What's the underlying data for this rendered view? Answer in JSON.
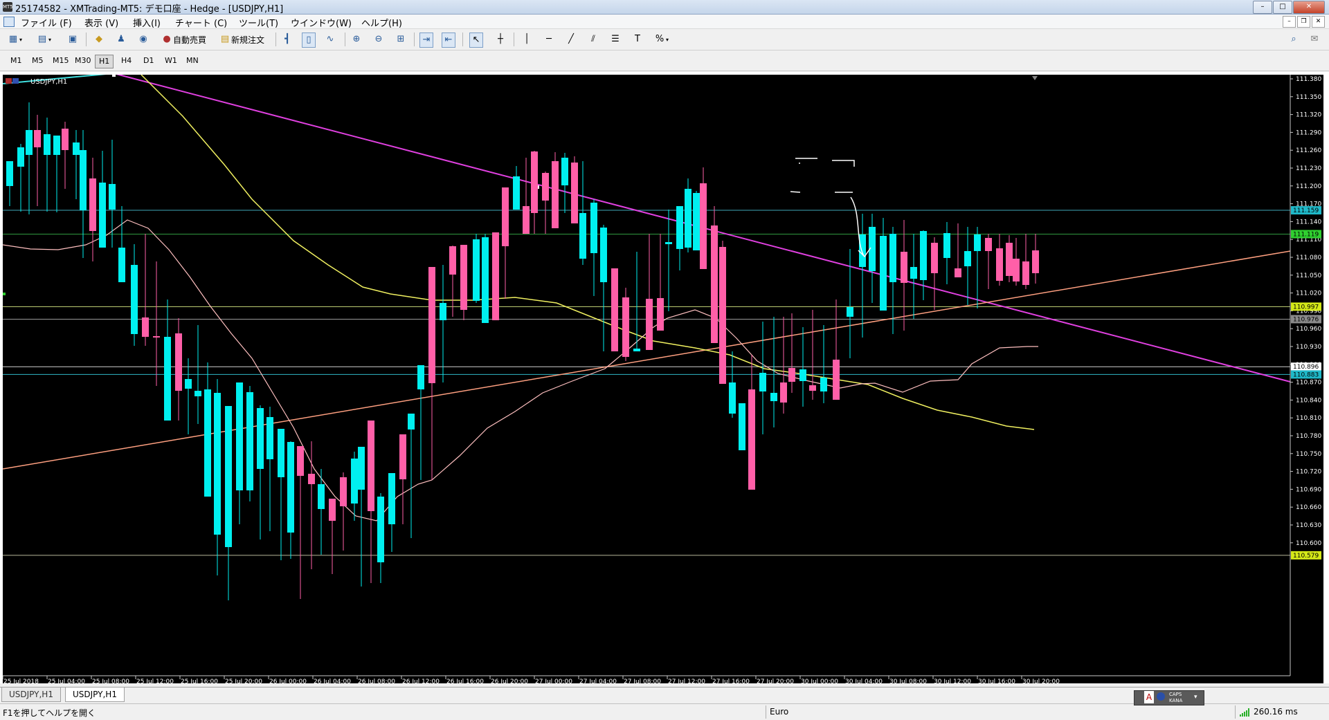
{
  "window": {
    "title": "25174582 - XMTrading-MT5: デモ口座 - Hedge - [USDJPY,H1]",
    "app_icon_text": "MT5",
    "min": "–",
    "max": "□",
    "close": "✕"
  },
  "mdi": {
    "min": "–",
    "restore": "❐",
    "close": "✕"
  },
  "menu": [
    "ファイル (F)",
    "表示 (V)",
    "挿入(I)",
    "チャート (C)",
    "ツール(T)",
    "ウインドウ(W)",
    "ヘルプ(H)"
  ],
  "toolbar": {
    "auto_trading": "自動売買",
    "new_order": "新規注文"
  },
  "timeframes": [
    "M1",
    "M5",
    "M15",
    "M30",
    "H1",
    "H4",
    "D1",
    "W1",
    "MN"
  ],
  "active_timeframe": "H1",
  "chart": {
    "symbol_label": "USDJPY,H1",
    "price_labels": [
      "111.380",
      "111.350",
      "111.320",
      "111.290",
      "111.260",
      "111.230",
      "111.200",
      "111.170",
      "111.140",
      "111.110",
      "111.080",
      "111.050",
      "111.020",
      "110.990",
      "110.960",
      "110.930",
      "110.900",
      "110.870",
      "110.840",
      "110.810",
      "110.780",
      "110.750",
      "110.720",
      "110.690",
      "110.660",
      "110.630",
      "110.600"
    ],
    "time_labels": [
      "25 Jul 2018",
      "25 Jul 04:00",
      "25 Jul 08:00",
      "25 Jul 12:00",
      "25 Jul 16:00",
      "25 Jul 20:00",
      "26 Jul 00:00",
      "26 Jul 04:00",
      "26 Jul 08:00",
      "26 Jul 12:00",
      "26 Jul 16:00",
      "26 Jul 20:00",
      "27 Jul 00:00",
      "27 Jul 04:00",
      "27 Jul 08:00",
      "27 Jul 12:00",
      "27 Jul 16:00",
      "27 Jul 20:00",
      "30 Jul 00:00",
      "30 Jul 04:00",
      "30 Jul 08:00",
      "30 Jul 12:00",
      "30 Jul 16:00",
      "30 Jul 20:00"
    ],
    "hlines": [
      {
        "price": 111.159,
        "label": "111.159",
        "color": "#3fa8b8",
        "badge": "#1fb8c8"
      },
      {
        "price": 111.119,
        "label": "111.119",
        "color": "#2f9a3f",
        "badge": "#2fcf2f"
      },
      {
        "price": 110.997,
        "label": "110.997",
        "color": "#c8d87a",
        "badge": "#d4e818"
      },
      {
        "price": 110.976,
        "label": "110.976",
        "color": "#9a9a9a",
        "badge": "#8a8a8a"
      },
      {
        "price": 110.896,
        "label": "110.896",
        "color": "#cfcfcf",
        "badge": "#ffffff"
      },
      {
        "price": 110.883,
        "label": "110.883",
        "color": "#2fb8c8",
        "badge": "#1fb8c8"
      },
      {
        "price": 110.579,
        "label": "110.579",
        "color": "#b8b89a",
        "badge": "#d4e818"
      }
    ],
    "annotation_text": "ここ",
    "colors": {
      "bull": "#ff5fa8",
      "bear": "#00f0f0",
      "bg": "#000000",
      "trend_down": "#e040e0",
      "trend_up": "#ffa080",
      "ma_slow": "#f0f060",
      "ma_fast": "#ffc0c0"
    }
  },
  "tabs": [
    "USDJPY,H1",
    "USDJPY,H1"
  ],
  "active_tab": 1,
  "status": {
    "help": "F1を押してヘルプを開く",
    "profile": "Euro",
    "ping": "260.16 ms",
    "caps": "CAPS",
    "kana": "KANA"
  }
}
